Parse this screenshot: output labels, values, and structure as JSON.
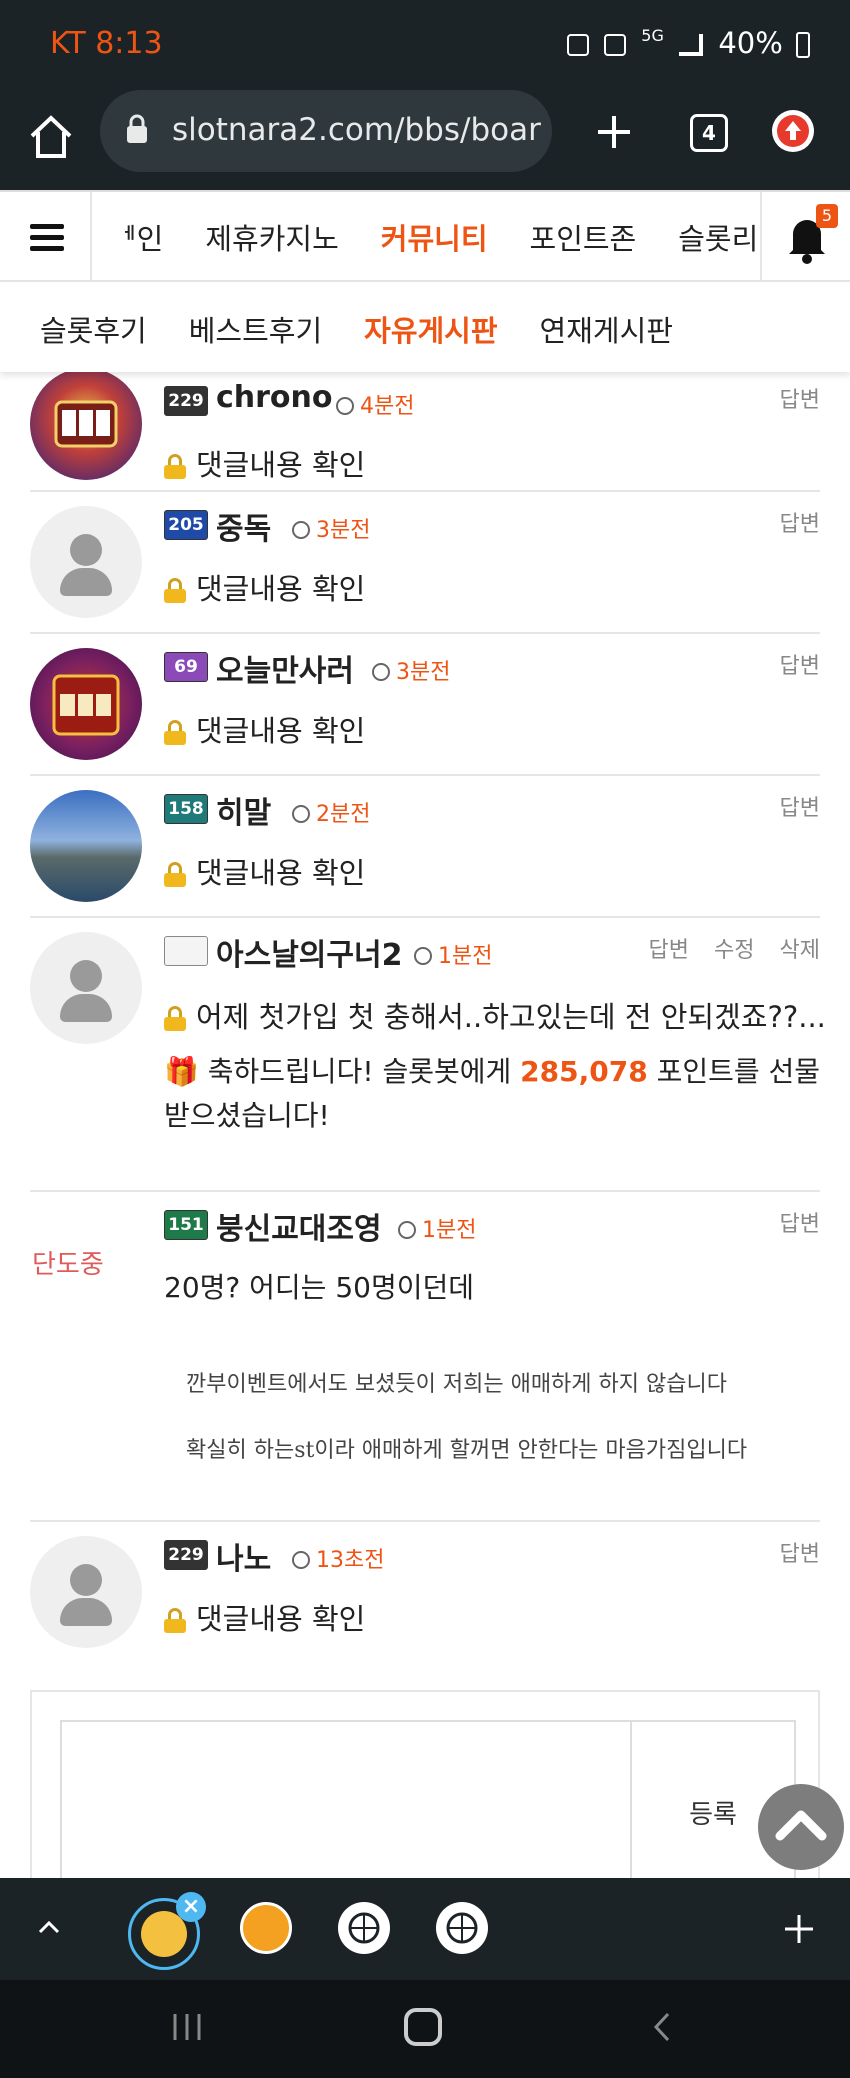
{
  "status_bar": {
    "carrier_time": "KT 8:13",
    "battery": "40%",
    "network": "5G"
  },
  "browser": {
    "url": "slotnara2.com/bbs/boar",
    "tab_count": "4"
  },
  "nav": {
    "items": [
      "ᅦ인",
      "제휴카지노",
      "커뮤니티",
      "포인트존",
      "슬롯리"
    ],
    "active_index": 2,
    "bell_badge": "5"
  },
  "subnav": {
    "items": [
      "슬롯후기",
      "베스트후기",
      "자유게시판",
      "연재게시판"
    ],
    "active_index": 2
  },
  "comments": [
    {
      "level": "229",
      "nick": "chrono",
      "time": "4분전",
      "actions": [
        "답변"
      ],
      "text": "댓글내용 확인",
      "avatar": "slot-machine"
    },
    {
      "level": "205",
      "nick": "중독",
      "time": "3분전",
      "actions": [
        "답변"
      ],
      "text": "댓글내용 확인",
      "avatar": "default"
    },
    {
      "level": "69",
      "nick": "오늘만사러",
      "time": "3분전",
      "actions": [
        "답변"
      ],
      "text": "댓글내용 확인",
      "avatar": "big-win"
    },
    {
      "level": "158",
      "nick": "히말",
      "time": "2분전",
      "actions": [
        "답변"
      ],
      "text": "댓글내용 확인",
      "avatar": "landscape"
    },
    {
      "level": "",
      "nick": "아스날의구너2",
      "time": "1분전",
      "actions": [
        "답변",
        "수정",
        "삭제"
      ],
      "text": "어제 첫가입 첫 충해서..하고있는데 전 안되겠죠??...",
      "gift_prefix": "축하드립니다! 슬롯봇에게 ",
      "gift_points": "285,078",
      "gift_suffix": " 포인트를 선물받으셨습니다!",
      "avatar": "default"
    },
    {
      "level": "151",
      "nick": "붕신교대조영",
      "time": "1분전",
      "actions": [
        "답변"
      ],
      "text": "20명? 어디는 50명이던데",
      "quote1": "깐부이벤트에서도 보셨듯이 저희는 애매하게 하지 않습니다",
      "quote2": "확실히 하는st이라 애매하게 할꺼면 안한다는 마음가짐입니다",
      "avatar": "signature",
      "avatar_text": "단도중"
    },
    {
      "level": "229",
      "nick": "나노",
      "time": "13초전",
      "actions": [
        "답변"
      ],
      "text": "댓글내용 확인",
      "avatar": "default"
    }
  ],
  "form": {
    "submit_label": "등록"
  },
  "colors": {
    "accent": "#ee5413",
    "dark": "#1c2326"
  }
}
